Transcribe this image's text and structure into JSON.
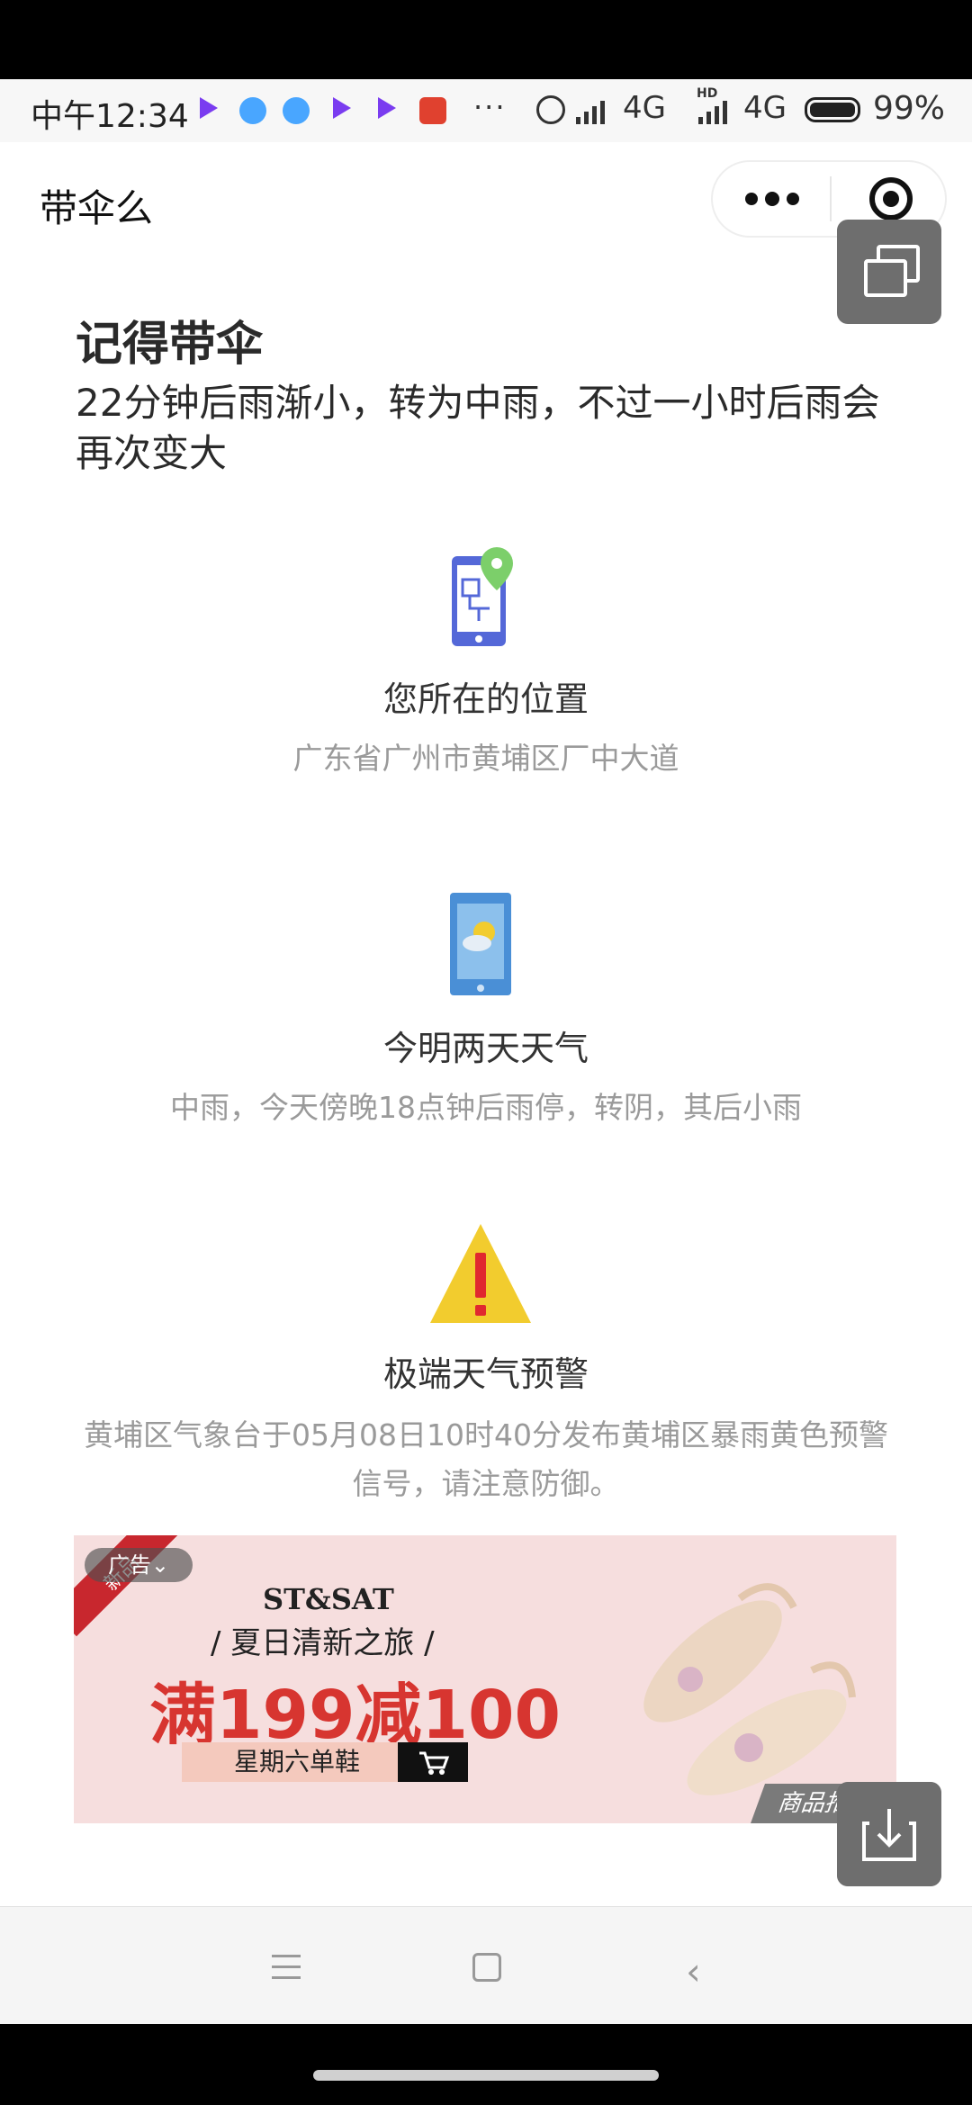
{
  "status_bar": {
    "time": "中午12:34",
    "more": "···",
    "network1": "4G",
    "hd": "HD",
    "network2": "4G",
    "battery": "99%"
  },
  "header": {
    "title": "带伞么"
  },
  "main": {
    "title": "记得带伞",
    "summary": "22分钟后雨渐小，转为中雨，不过一小时后雨会再次变大"
  },
  "sections": [
    {
      "title": "您所在的位置",
      "desc": "广东省广州市黄埔区厂中大道"
    },
    {
      "title": "今明两天天气",
      "desc": "中雨，今天傍晚18点钟后雨停，转阴，其后小雨"
    },
    {
      "title": "极端天气预警",
      "desc": "黄埔区气象台于05月08日10时40分发布黄埔区暴雨黄色预警信号，请注意防御。"
    }
  ],
  "ad": {
    "corner": "新品",
    "tag": "广告⌄",
    "brand": "ST&SAT",
    "subtitle": "/ 夏日清新之旅 /",
    "deal": "满199减100",
    "cta": "星期六单鞋",
    "corner_right": "商品推"
  },
  "colors": {
    "brand_red": "#d73530",
    "pin_green": "#7ccf6a",
    "phone_blue": "#5468d8",
    "warn_yellow": "#f2cc2e",
    "warn_red": "#e0282f"
  }
}
